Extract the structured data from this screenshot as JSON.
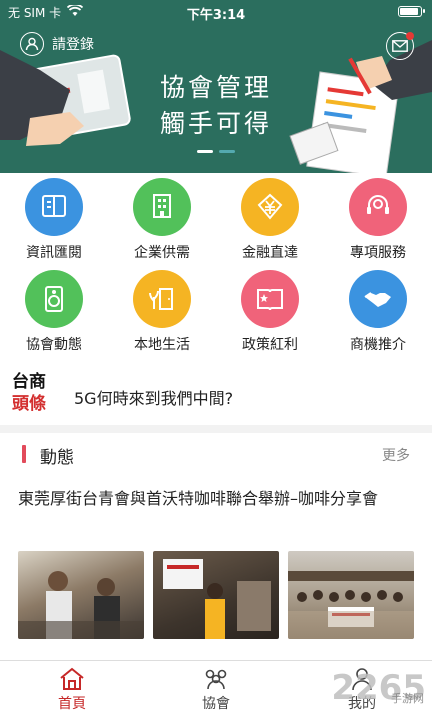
{
  "status": {
    "carrier": "无 SIM 卡",
    "time": "下午3:14",
    "battery_level": 0.95
  },
  "header": {
    "login_label": "請登錄"
  },
  "banner": {
    "line1": "協會管理",
    "line2": "觸手可得"
  },
  "menu": [
    {
      "label": "資訊匯閱",
      "color": "#3b93e0",
      "icon": "book-icon"
    },
    {
      "label": "企業供需",
      "color": "#52c15a",
      "icon": "building-icon"
    },
    {
      "label": "金融直達",
      "color": "#f5b423",
      "icon": "yen-diamond-icon"
    },
    {
      "label": "專項服務",
      "color": "#f0637a",
      "icon": "headset-icon"
    },
    {
      "label": "協會動態",
      "color": "#52c15a",
      "icon": "speaker-icon"
    },
    {
      "label": "本地生活",
      "color": "#f5b423",
      "icon": "plant-door-icon"
    },
    {
      "label": "政策紅利",
      "color": "#f0637a",
      "icon": "star-book-icon"
    },
    {
      "label": "商機推介",
      "color": "#3b93e0",
      "icon": "handshake-icon"
    }
  ],
  "ticker": {
    "badge_line1": "台商",
    "badge_line2": "頭條",
    "text": "5G何時來到我們中間?"
  },
  "news": {
    "section_title": "動態",
    "more_label": "更多",
    "article_title": "東莞厚街台青會與首沃特咖啡聯合舉辦–咖啡分享會"
  },
  "tabs": [
    {
      "label": "首頁",
      "icon": "home-icon"
    },
    {
      "label": "協會",
      "icon": "group-icon"
    },
    {
      "label": "我的",
      "icon": "person-icon"
    }
  ],
  "watermark": {
    "text": "2265",
    "sub": "手游网"
  },
  "colors": {
    "banner_bg": "#2b6e5e",
    "accent_red": "#c62828",
    "section_bar": "#e24b5b"
  }
}
